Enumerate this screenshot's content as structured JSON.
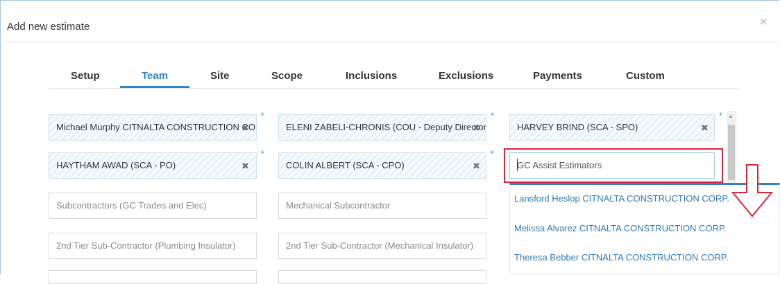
{
  "dialog": {
    "title": "Add new estimate",
    "close_glyph": "×"
  },
  "tabs": [
    {
      "label": "Setup",
      "active": false
    },
    {
      "label": "Team",
      "active": true
    },
    {
      "label": "Site",
      "active": false
    },
    {
      "label": "Scope",
      "active": false
    },
    {
      "label": "Inclusions",
      "active": false
    },
    {
      "label": "Exclusions",
      "active": false
    },
    {
      "label": "Payments",
      "active": false
    },
    {
      "label": "Custom",
      "active": false
    }
  ],
  "team_fields": {
    "r1c1": "Michael Murphy CITNALTA CONSTRUCTION CORP.",
    "r1c2": "ELENI ZABELI-CHRONIS (COU - Deputy Director)",
    "r1c3": "HARVEY BRIND (SCA - SPO)",
    "r2c1": "HAYTHAM AWAD (SCA - PO)",
    "r2c2": "COLIN ALBERT (SCA - CPO)",
    "r3c1_placeholder": "Subcontractors (GC Trades and Elec)",
    "r3c2_placeholder": "Mechanical Subcontractor",
    "r4c1_placeholder": "2nd Tier Sub-Contractor (Plumbing Insulator)",
    "r4c2_placeholder": "2nd Tier Sub-Contractor (Mechanical Insulator)"
  },
  "required_mark": "*",
  "remove_glyph": "✖",
  "gc_input": {
    "placeholder": "GC Assist Estimators"
  },
  "dropdown_options": [
    "Lansford Heslop CITNALTA CONSTRUCTION CORP.",
    "Melissa Alvarez CITNALTA CONSTRUCTION CORP.",
    "Theresa Bebber CITNALTA CONSTRUCTION CORP."
  ],
  "colors": {
    "accent": "#2c84c6",
    "highlight": "#d9263a"
  }
}
